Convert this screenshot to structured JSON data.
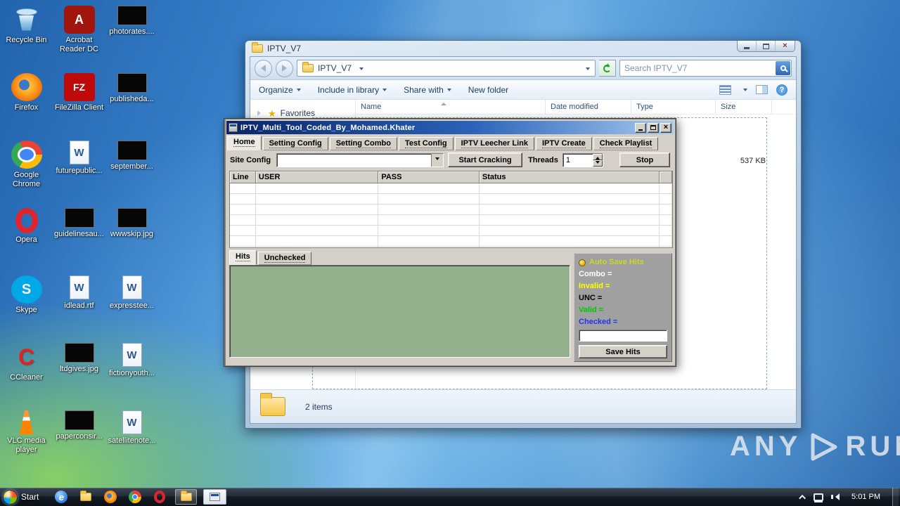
{
  "colors": {
    "iptv_titlebar_left": "#0a246a",
    "iptv_titlebar_right": "#a6caf0",
    "hits_panel_green": "#92b08c",
    "auto_save_hits_label": "#c8d829",
    "invalid_label": "#ffff00",
    "valid_label": "#00c800",
    "checked_label": "#2233ee",
    "search_button_blue": "#2f66b8"
  },
  "desktop": {
    "icons": [
      {
        "icon": "recycle-bin",
        "label": "Recycle Bin"
      },
      {
        "icon": "acrobat",
        "label": "Acrobat Reader DC"
      },
      {
        "icon": "image-file",
        "label": "photorates...."
      },
      {
        "icon": "firefox",
        "label": "Firefox"
      },
      {
        "icon": "filezilla",
        "label": "FileZilla Client"
      },
      {
        "icon": "image-file",
        "label": "publisheda..."
      },
      {
        "icon": "chrome",
        "label": "Google Chrome"
      },
      {
        "icon": "word-doc",
        "label": "futurepublic..."
      },
      {
        "icon": "image-file",
        "label": "september..."
      },
      {
        "icon": "opera",
        "label": "Opera"
      },
      {
        "icon": "image-file",
        "label": "guidelinesau..."
      },
      {
        "icon": "image-file",
        "label": "wwwskip.jpg"
      },
      {
        "icon": "skype",
        "label": "Skype"
      },
      {
        "icon": "word-doc",
        "label": "idlead.rtf"
      },
      {
        "icon": "word-doc",
        "label": "expresstee..."
      },
      {
        "icon": "ccleaner",
        "label": "CCleaner"
      },
      {
        "icon": "image-file",
        "label": "ltdgives.jpg"
      },
      {
        "icon": "word-doc",
        "label": "fictionyouth..."
      },
      {
        "icon": "vlc",
        "label": "VLC media player"
      },
      {
        "icon": "image-file",
        "label": "paperconsir..."
      },
      {
        "icon": "word-doc",
        "label": "satellitenote..."
      }
    ]
  },
  "explorer": {
    "title": "IPTV_V7",
    "breadcrumb": "IPTV_V7",
    "search_placeholder": "Search IPTV_V7",
    "toolbar": [
      {
        "label": "Organize",
        "caret": true
      },
      {
        "label": "Include in library",
        "caret": true
      },
      {
        "label": "Share with",
        "caret": true
      },
      {
        "label": "New folder",
        "caret": false
      }
    ],
    "columns": [
      "Name",
      "Date modified",
      "Type",
      "Size"
    ],
    "favorites_label": "Favorites",
    "visible_file_size": "537 KB",
    "status_items": "2 items"
  },
  "iptv": {
    "title": "IPTV_Multi_Tool_Coded_By_Mohamed.Khater",
    "tabs": [
      "Home",
      "Setting Config",
      "Setting Combo",
      "Test Config",
      "IPTV Leecher Link",
      "IPTV Create",
      "Check Playlist"
    ],
    "active_tab": "Home",
    "site_config_label": "Site Config",
    "site_config_value": "",
    "start_button": "Start Cracking",
    "threads_label": "Threads",
    "threads_value": "1",
    "stop_button": "Stop",
    "grid_columns": [
      "Line",
      "USER",
      "PASS",
      "Status"
    ],
    "result_tabs": [
      "Hits",
      "Unchecked"
    ],
    "active_result_tab": "Hits",
    "side_panel": {
      "auto_save_label": "Auto Save Hits",
      "combo_label": "Combo =",
      "invalid_label": "Invalid =",
      "unc_label": "UNC =",
      "valid_label": "Valid =",
      "checked_label": "Checked =",
      "hits_path_value": "",
      "save_button": "Save Hits"
    }
  },
  "taskbar": {
    "start_label": "Start",
    "clock": "5:01 PM"
  },
  "watermark": {
    "left": "ANY",
    "right": "RUN"
  }
}
